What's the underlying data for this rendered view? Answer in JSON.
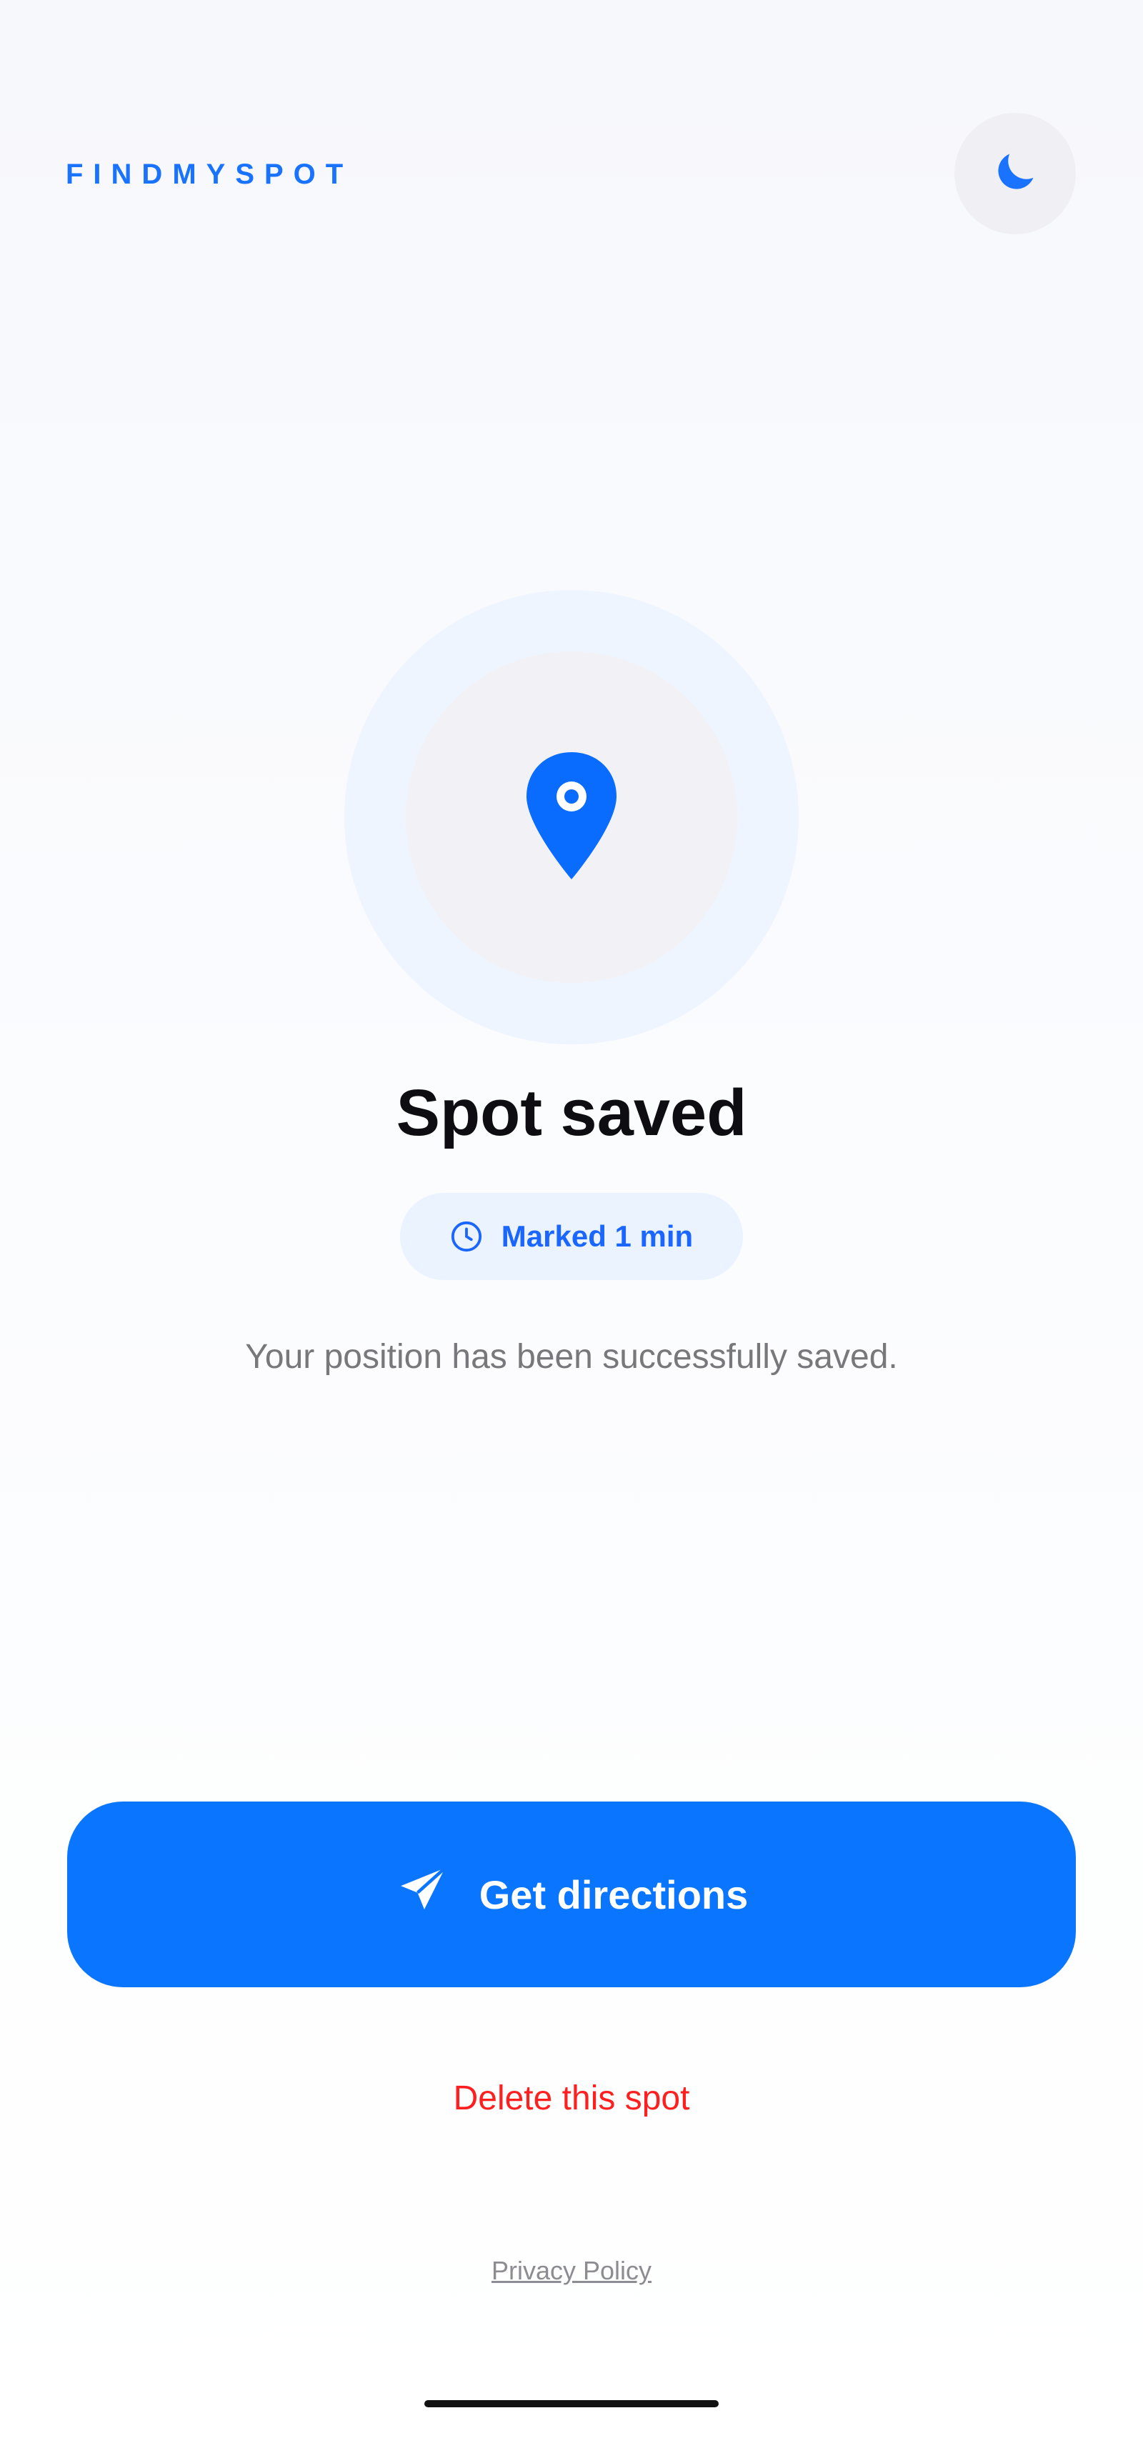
{
  "header": {
    "brand": "FINDMYSPOT",
    "theme_toggle_icon": "moon-icon"
  },
  "hero": {
    "icon": "location-pin-icon",
    "title": "Spot saved",
    "badge_icon": "clock-icon",
    "badge_text": "Marked 1 min",
    "subtitle": "Your position has been successfully saved."
  },
  "actions": {
    "primary_icon": "send-icon",
    "primary_label": "Get directions",
    "delete_label": "Delete this spot",
    "privacy_label": "Privacy Policy"
  },
  "colors": {
    "accent": "#0a75ff",
    "danger": "#ff1f1f",
    "muted": "#77777c",
    "background": "#f7f8fc"
  }
}
